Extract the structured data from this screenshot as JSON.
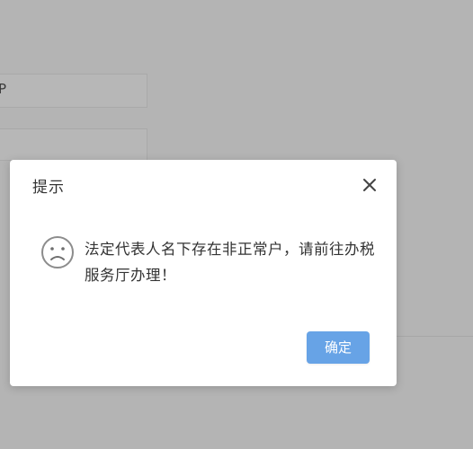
{
  "background": {
    "input_fragment": "P"
  },
  "dialog": {
    "title": "提示",
    "icon": "sad-face-icon",
    "message": "法定代表人名下存在非正常户，请前往办税服务厅办理！",
    "confirm_label": "确定",
    "close_icon": "close-icon"
  },
  "colors": {
    "overlay": "#b3b3b3",
    "dialog_bg": "#ffffff",
    "confirm_button": "#67a3e6",
    "text": "#333333"
  }
}
